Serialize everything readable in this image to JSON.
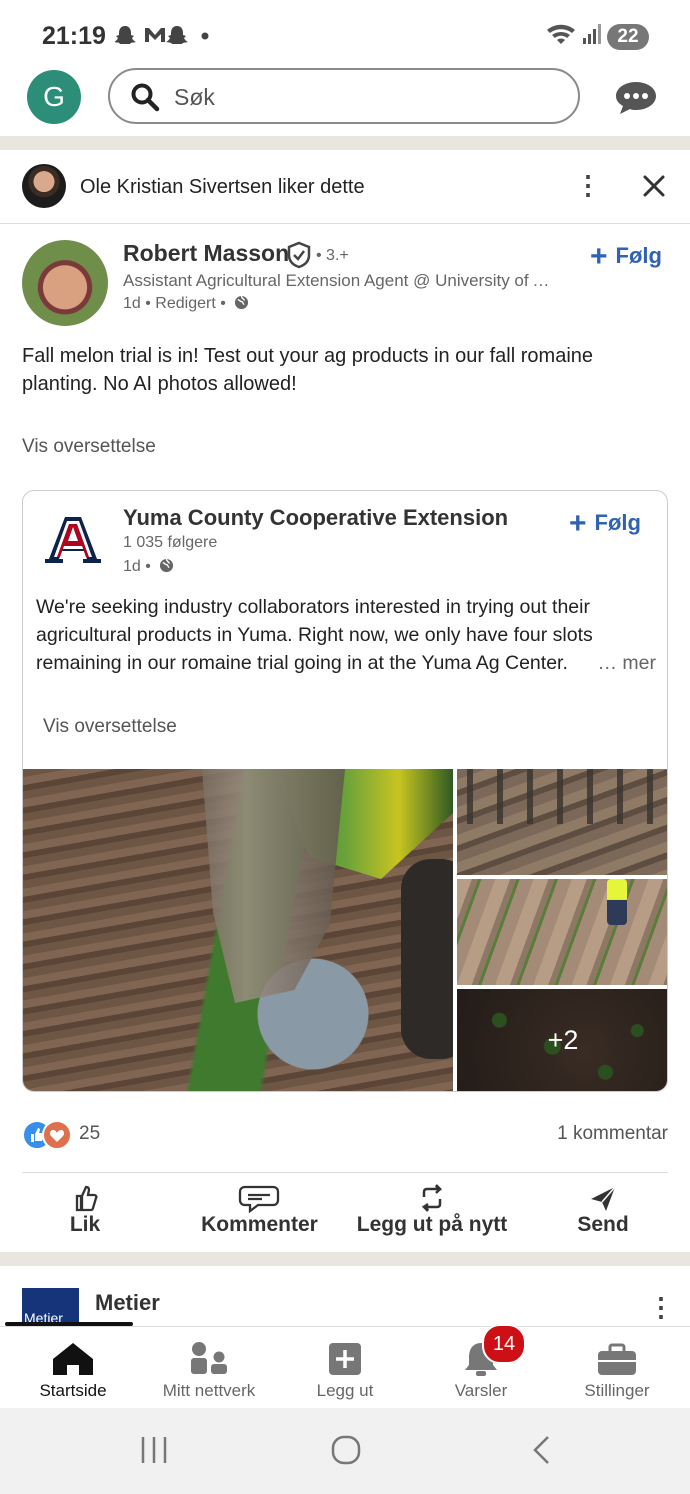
{
  "status_bar": {
    "time": "21:19",
    "notif_icons": "snapchat-icon gmail-icon snapchat-icon dot",
    "battery": "22"
  },
  "top_bar": {
    "avatar_letter": "G",
    "search_placeholder": "Søk"
  },
  "social_context": {
    "text": "Ole Kristian Sivertsen liker dette"
  },
  "post": {
    "author": "Robert Masson",
    "degree": "• 3.+",
    "headline": "Assistant Agricultural Extension Agent @ University of Arizona",
    "meta": "1d • Redigert •",
    "follow_label": "Følg",
    "text": "Fall melon trial is in! Test out your ag products in our fall romaine planting. No AI photos allowed!",
    "translate_label": "Vis oversettelse"
  },
  "shared": {
    "org": "Yuma County Cooperative Extension",
    "followers": "1 035 følgere",
    "meta": "1d •",
    "follow_label": "Følg",
    "text": "We're seeking industry collaborators interested in trying out their agricultural products in Yuma. Right now, we only have four slots remaining in our romaine trial going in at the Yuma Ag Center.",
    "more_label": "… mer",
    "translate_label": "Vis oversettelse",
    "extra_photos": "+2"
  },
  "engagement": {
    "reaction_count": "25",
    "comments": "1 kommentar"
  },
  "actions": [
    {
      "label": "Lik",
      "icon": "like-icon"
    },
    {
      "label": "Kommenter",
      "icon": "comment-icon"
    },
    {
      "label": "Legg ut på nytt",
      "icon": "repost-icon"
    },
    {
      "label": "Send",
      "icon": "send-icon"
    }
  ],
  "next_post": {
    "logo_text": "Metier",
    "name": "Metier"
  },
  "bottom_nav": [
    {
      "label": "Startside",
      "icon": "home-icon"
    },
    {
      "label": "Mitt nettverk",
      "icon": "network-icon"
    },
    {
      "label": "Legg ut",
      "icon": "post-icon"
    },
    {
      "label": "Varsler",
      "icon": "bell-icon"
    },
    {
      "label": "Stillinger",
      "icon": "briefcase-icon"
    }
  ],
  "notifications_badge": "14",
  "colors": {
    "accent": "#2f63b2",
    "badge": "#cc1016",
    "avatar": "#2c8e78"
  }
}
